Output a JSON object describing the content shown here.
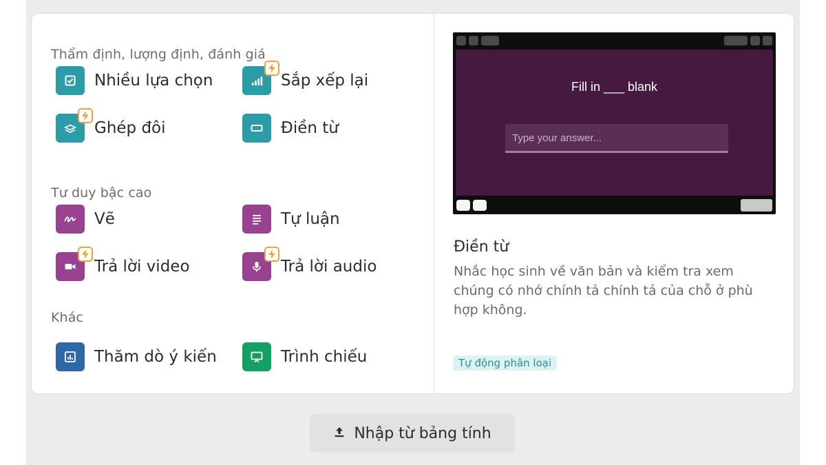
{
  "sections": {
    "assessment": {
      "title": "Thẩm định, lượng định, đánh giá",
      "items": [
        {
          "label": "Nhiều lựa chọn",
          "icon": "checkbox-icon",
          "color": "#2c9ca6",
          "bolt": false
        },
        {
          "label": "Sắp xếp lại",
          "icon": "bar-chart-icon",
          "color": "#2c9ca6",
          "bolt": true
        },
        {
          "label": "Ghép đôi",
          "icon": "match-icon",
          "color": "#2c9ca6",
          "bolt": true
        },
        {
          "label": "Điền từ",
          "icon": "blank-box-icon",
          "color": "#2c9ca6",
          "bolt": false
        }
      ]
    },
    "higher_order": {
      "title": "Tư duy bậc cao",
      "items": [
        {
          "label": "Vẽ",
          "icon": "draw-icon",
          "color": "#9a4292",
          "bolt": false
        },
        {
          "label": "Tự luận",
          "icon": "text-lines-icon",
          "color": "#9a4292",
          "bolt": false
        },
        {
          "label": "Trả lời video",
          "icon": "video-icon",
          "color": "#9a4292",
          "bolt": true
        },
        {
          "label": "Trả lời audio",
          "icon": "microphone-icon",
          "color": "#9a4292",
          "bolt": true
        }
      ]
    },
    "other": {
      "title": "Khác",
      "items": [
        {
          "label": "Thăm dò ý kiến",
          "icon": "poll-icon",
          "color": "#2e68a8",
          "bolt": false
        },
        {
          "label": "Trình chiếu",
          "icon": "presentation-icon",
          "color": "#13a062",
          "bolt": false
        }
      ]
    }
  },
  "preview": {
    "question": "Fill in ___ blank",
    "input_placeholder": "Type your answer..."
  },
  "detail": {
    "title": "Điền từ",
    "description": "Nhắc học sinh về văn bản và kiểm tra xem chúng có nhớ chính tả chính tả của chỗ ở phù hợp không.",
    "tag": "Tự động phân loại"
  },
  "import_button": {
    "label": "Nhập từ bảng tính",
    "icon": "upload-icon"
  },
  "colors": {
    "teal": "#2c9ca6",
    "purple": "#9a4292",
    "blue": "#2e68a8",
    "green": "#13a062",
    "bolt": "#f3a13b"
  }
}
